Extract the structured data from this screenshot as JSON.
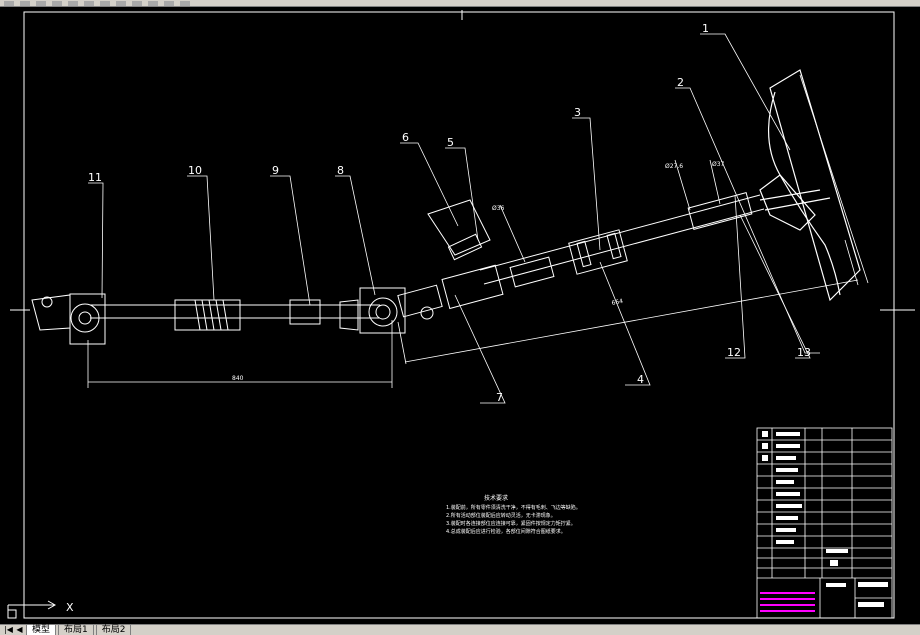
{
  "toolbar": {
    "icons": [
      "new-icon",
      "open-icon",
      "save-icon",
      "print-icon",
      "cut-icon",
      "copy-icon",
      "paste-icon",
      "undo-icon",
      "redo-icon",
      "pan-icon",
      "zoom-icon",
      "properties-icon"
    ]
  },
  "drawing": {
    "part_numbers": [
      "1",
      "2",
      "3",
      "4",
      "5",
      "6",
      "7",
      "8",
      "9",
      "10",
      "11",
      "12",
      "13"
    ],
    "dimensions": {
      "lower_length": "840",
      "upper_length": "664",
      "diam_a": "Ø36",
      "diam_b": "Ø27.6",
      "diam_c": "Ø37"
    },
    "technical_requirements": {
      "title": "技术要求",
      "lines": [
        "1.装配前，所有零件须清洗干净，不得有毛刺、飞边等缺陷。",
        "2.所有活动部位装配后应转动灵活，无卡滞现象。",
        "3.装配时各连接部位应连接可靠，紧固件按规定力矩拧紧。",
        "4.总成装配后应进行检验，各部位间隙符合图纸要求。"
      ]
    },
    "title_block": {
      "sheet": "1:1"
    },
    "ucs": {
      "x_label": "X"
    }
  },
  "layout_tabs": [
    {
      "label": "模型"
    },
    {
      "label": "布局1"
    },
    {
      "label": "布局2"
    }
  ]
}
